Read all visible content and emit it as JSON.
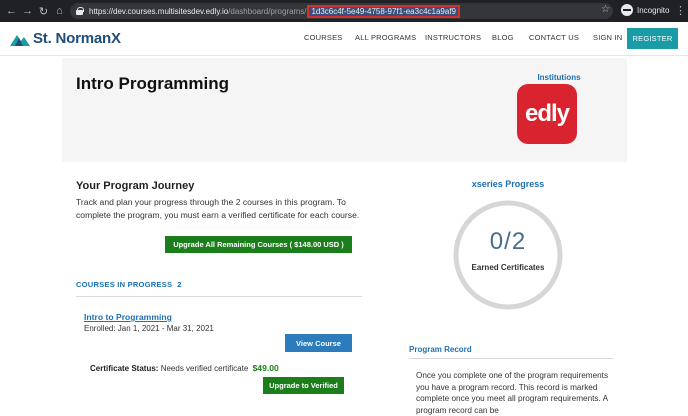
{
  "browser": {
    "url_host": "https://dev.courses.multisitesdev.edly.io",
    "url_path": "/dashboard/programs/",
    "url_highlight": "1d3c6c4f-5e49-4758-97f1-ea3c4c1a9af9",
    "profile_label": "Incognito"
  },
  "site": {
    "logo_text": "St. NormanX",
    "nav": [
      "COURSES",
      "ALL PROGRAMS",
      "INSTRUCTORS",
      "BLOG",
      "CONTACT US",
      "SIGN IN"
    ],
    "register_label": "REGISTER"
  },
  "banner": {
    "title": "Intro Programming",
    "institutions_label": "Institutions",
    "institution_logo_text": "edly"
  },
  "journey": {
    "title": "Your Program Journey",
    "text": "Track and plan your progress through the 2 courses in this program. To complete the program, you must earn a verified certificate for each course.",
    "upgrade_all_label": "Upgrade All Remaining Courses ( $148.00 USD )"
  },
  "courses_in_progress": {
    "heading": "COURSES IN PROGRESS",
    "count": "2",
    "items": [
      {
        "title": "Intro to Programming",
        "enrolled": "Enrolled: Jan 1, 2021 - Mar 31, 2021",
        "view_label": "View Course",
        "cert_status_label": "Certificate Status:",
        "cert_status_value": "Needs verified certificate",
        "price": "$49.00",
        "upgrade_label": "Upgrade to Verified"
      }
    ]
  },
  "xseries": {
    "title": "xseries Progress",
    "earned": "0",
    "total": "2",
    "separator": "/",
    "label": "Earned Certificates"
  },
  "program_record": {
    "title": "Program Record",
    "text": "Once you complete one of the program requirements you have a program record. This record is marked complete once you meet all program requirements. A program record can be"
  },
  "colors": {
    "brand": "#1f4e79",
    "accent_teal": "#1a9ca6",
    "link_blue": "#1e6fb3",
    "green": "#1b7e1b",
    "edly_red": "#d9232e"
  }
}
